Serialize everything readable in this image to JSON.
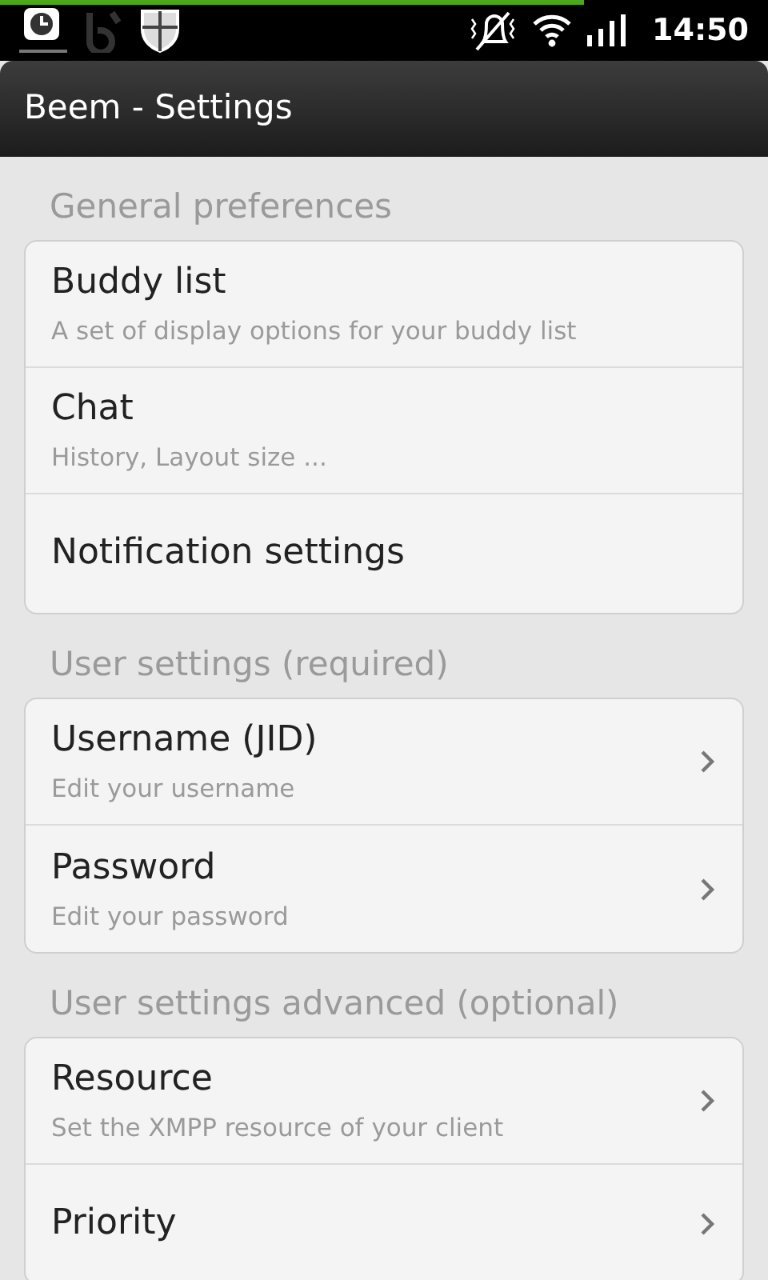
{
  "status_bar": {
    "progress": {
      "level": 0.76
    },
    "time": "14:50"
  },
  "window": {
    "title": "Beem - Settings"
  },
  "sections": [
    {
      "title": "General preferences",
      "items": [
        {
          "kind": "screen",
          "title": "Buddy list",
          "summary": "A set of display options for your buddy list"
        },
        {
          "kind": "screen",
          "title": "Chat",
          "summary": "History, Layout size ..."
        },
        {
          "kind": "screen",
          "title": "Notification settings"
        }
      ]
    },
    {
      "title": "User settings (required)",
      "items": [
        {
          "kind": "dialog",
          "title": "Username (JID)",
          "summary": "Edit your username"
        },
        {
          "kind": "dialog",
          "title": "Password",
          "summary": "Edit your password"
        }
      ]
    },
    {
      "title": "User settings advanced (optional)",
      "items": [
        {
          "kind": "dialog",
          "title": "Resource",
          "summary": "Set the XMPP resource of your client"
        },
        {
          "kind": "dialog",
          "title": "Priority"
        }
      ]
    }
  ]
}
